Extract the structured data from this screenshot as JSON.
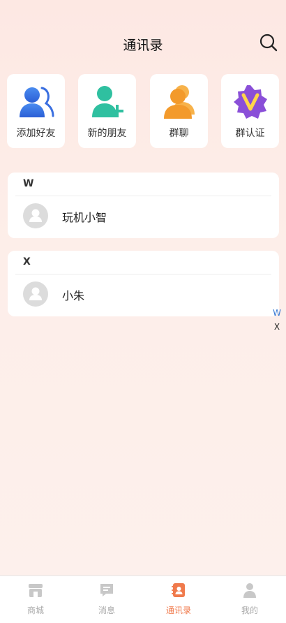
{
  "header": {
    "title": "通讯录"
  },
  "tiles": [
    {
      "label": "添加好友",
      "icon": "add-friend-icon"
    },
    {
      "label": "新的朋友",
      "icon": "new-friend-icon"
    },
    {
      "label": "群聊",
      "icon": "group-chat-icon"
    },
    {
      "label": "群认证",
      "icon": "group-verify-icon"
    }
  ],
  "sections": [
    {
      "letter": "W",
      "contacts": [
        {
          "name": "玩机小智"
        }
      ]
    },
    {
      "letter": "X",
      "contacts": [
        {
          "name": "小朱"
        }
      ]
    }
  ],
  "index": {
    "items": [
      "W",
      "X"
    ],
    "active": "W"
  },
  "tabbar": {
    "items": [
      {
        "label": "商城",
        "icon": "store-icon"
      },
      {
        "label": "消息",
        "icon": "message-icon"
      },
      {
        "label": "通讯录",
        "icon": "contacts-icon"
      },
      {
        "label": "我的",
        "icon": "profile-icon"
      }
    ],
    "active": "通讯录"
  },
  "colors": {
    "accent": "#f07a4c",
    "index_active": "#3a7bd5",
    "background": "#fdeee9"
  }
}
